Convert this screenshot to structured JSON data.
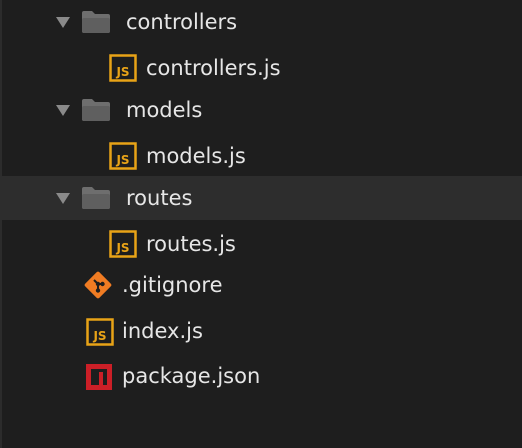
{
  "explorer": {
    "items": [
      {
        "label": "controllers",
        "kind": "folder",
        "expanded": true,
        "icon": "folder-icon"
      },
      {
        "label": "controllers.js",
        "kind": "file",
        "icon": "js-file-icon",
        "icon_text": "JS"
      },
      {
        "label": "models",
        "kind": "folder",
        "expanded": true,
        "icon": "folder-icon"
      },
      {
        "label": "models.js",
        "kind": "file",
        "icon": "js-file-icon",
        "icon_text": "JS"
      },
      {
        "label": "routes",
        "kind": "folder",
        "expanded": true,
        "selected": true,
        "icon": "folder-icon"
      },
      {
        "label": "routes.js",
        "kind": "file",
        "icon": "js-file-icon",
        "icon_text": "JS"
      },
      {
        "label": ".gitignore",
        "kind": "file",
        "icon": "git-icon"
      },
      {
        "label": "index.js",
        "kind": "file",
        "icon": "js-file-icon",
        "icon_text": "JS"
      },
      {
        "label": "package.json",
        "kind": "file",
        "icon": "npm-icon"
      }
    ]
  },
  "colors": {
    "background": "#1e1e1e",
    "selected_row": "#2d2d2d",
    "text": "#e6e6e6",
    "chevron": "#8a8a8a",
    "folder": "#6e6e6e",
    "js_icon": "#e8a317",
    "git_icon": "#f07c23",
    "npm_icon": "#cc1f27"
  }
}
